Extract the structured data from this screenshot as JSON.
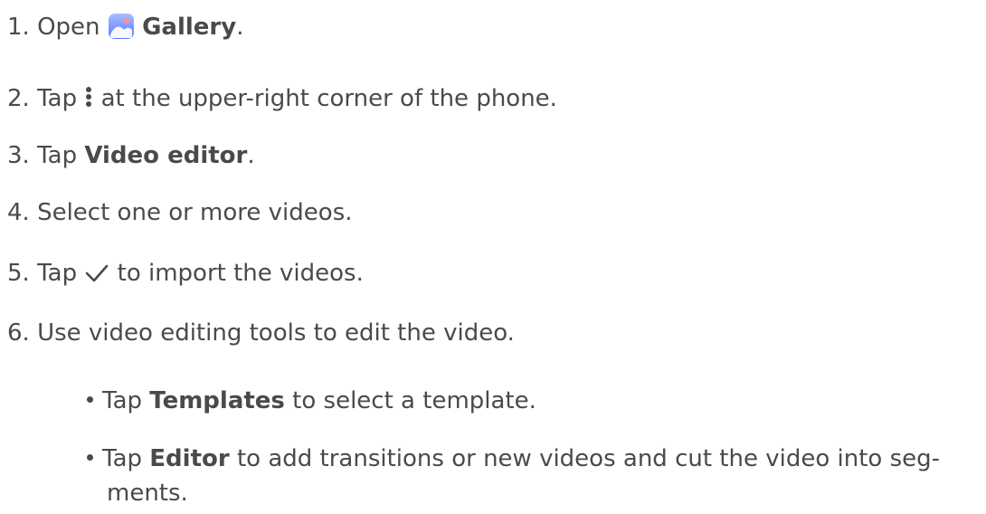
{
  "steps": [
    {
      "num": "1.",
      "before": "Open",
      "bold": "Gallery",
      "after": "."
    },
    {
      "num": "2.",
      "before": "Tap",
      "after": "at the upper-right corner of the phone."
    },
    {
      "num": "3.",
      "before": "Tap",
      "bold": "Video editor",
      "after": "."
    },
    {
      "num": "4.",
      "text": "Select one or more videos."
    },
    {
      "num": "5.",
      "before": "Tap",
      "after": "to import the videos."
    },
    {
      "num": "6.",
      "text": "Use video editing tools to edit the video."
    }
  ],
  "bullets": [
    {
      "before": "Tap",
      "bold": "Templates",
      "after": "to select a template."
    },
    {
      "before": "Tap",
      "bold": "Editor",
      "after": "to add transitions or new videos and cut the video into seg-",
      "continuation": "ments."
    }
  ],
  "icons": {
    "gallery": "gallery-app-icon",
    "more": "more-options-icon",
    "check": "checkmark-icon"
  },
  "colors": {
    "text": "#4a4a4a",
    "gallery_icon_top": "#9fb4ff",
    "gallery_icon_bottom": "#5f7dff"
  }
}
